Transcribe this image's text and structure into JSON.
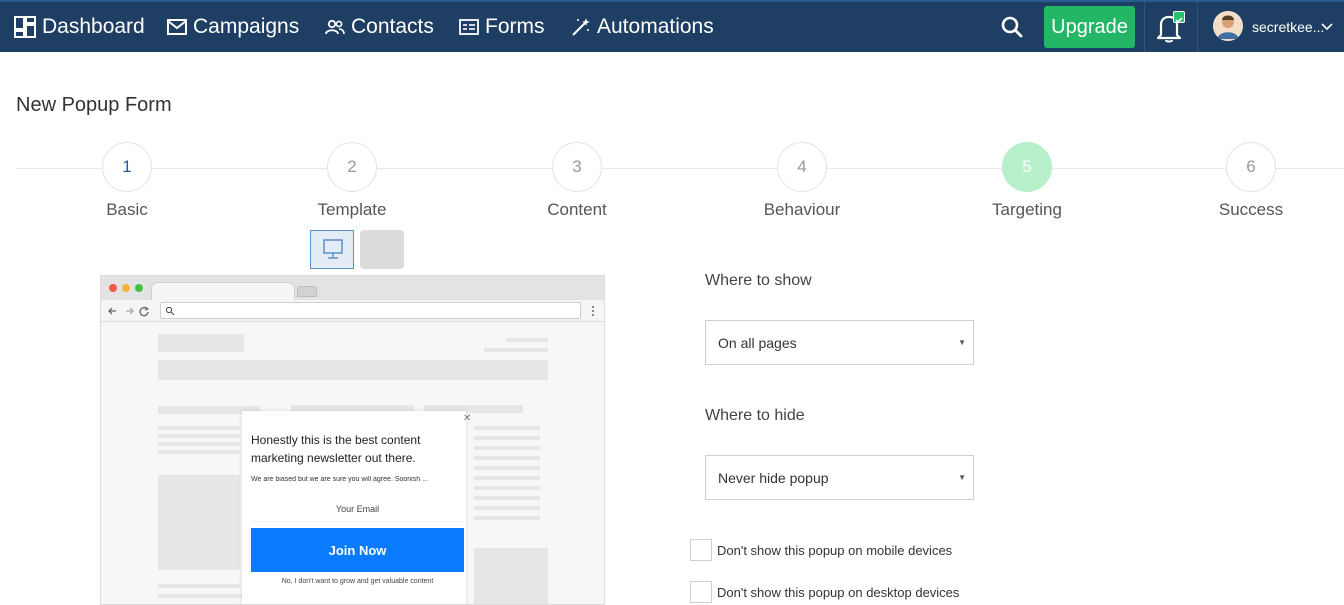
{
  "nav": {
    "items": [
      {
        "label": "Dashboard",
        "icon": "dashboard-icon"
      },
      {
        "label": "Campaigns",
        "icon": "envelope-icon"
      },
      {
        "label": "Contacts",
        "icon": "users-icon"
      },
      {
        "label": "Forms",
        "icon": "form-icon"
      },
      {
        "label": "Automations",
        "icon": "magic-wand-icon"
      }
    ],
    "upgrade_label": "Upgrade",
    "username": "secretkee...",
    "colors": {
      "bar": "#1e3f63",
      "upgrade": "#23b667",
      "notification_badge": "#27c26b"
    }
  },
  "page": {
    "title": "New Popup Form"
  },
  "stepper": {
    "active_step": 5,
    "steps": [
      {
        "number": "1",
        "label": "Basic"
      },
      {
        "number": "2",
        "label": "Template"
      },
      {
        "number": "3",
        "label": "Content"
      },
      {
        "number": "4",
        "label": "Behaviour"
      },
      {
        "number": "5",
        "label": "Targeting"
      },
      {
        "number": "6",
        "label": "Success"
      }
    ]
  },
  "preview": {
    "device_options": [
      "desktop-icon",
      "mobile-icon"
    ],
    "selected_device": "desktop-icon",
    "popup": {
      "headline": "Honestly this is the best content marketing newsletter out there.",
      "subtext": "We are biased but we are sure you will agree. Soonish ...",
      "email_placeholder": "Your Email",
      "button_label": "Join Now",
      "decline_label": "No, I don't want to grow and get valuable content",
      "button_color": "#0a7aff"
    }
  },
  "targeting": {
    "where_to_show": {
      "label": "Where to show",
      "value": "On all pages"
    },
    "where_to_hide": {
      "label": "Where to hide",
      "value": "Never hide popup"
    },
    "mobile_checkbox": {
      "label": "Don't show this popup on mobile devices",
      "checked": false
    },
    "desktop_checkbox": {
      "label": "Don't show this popup on desktop devices",
      "checked": false
    }
  }
}
